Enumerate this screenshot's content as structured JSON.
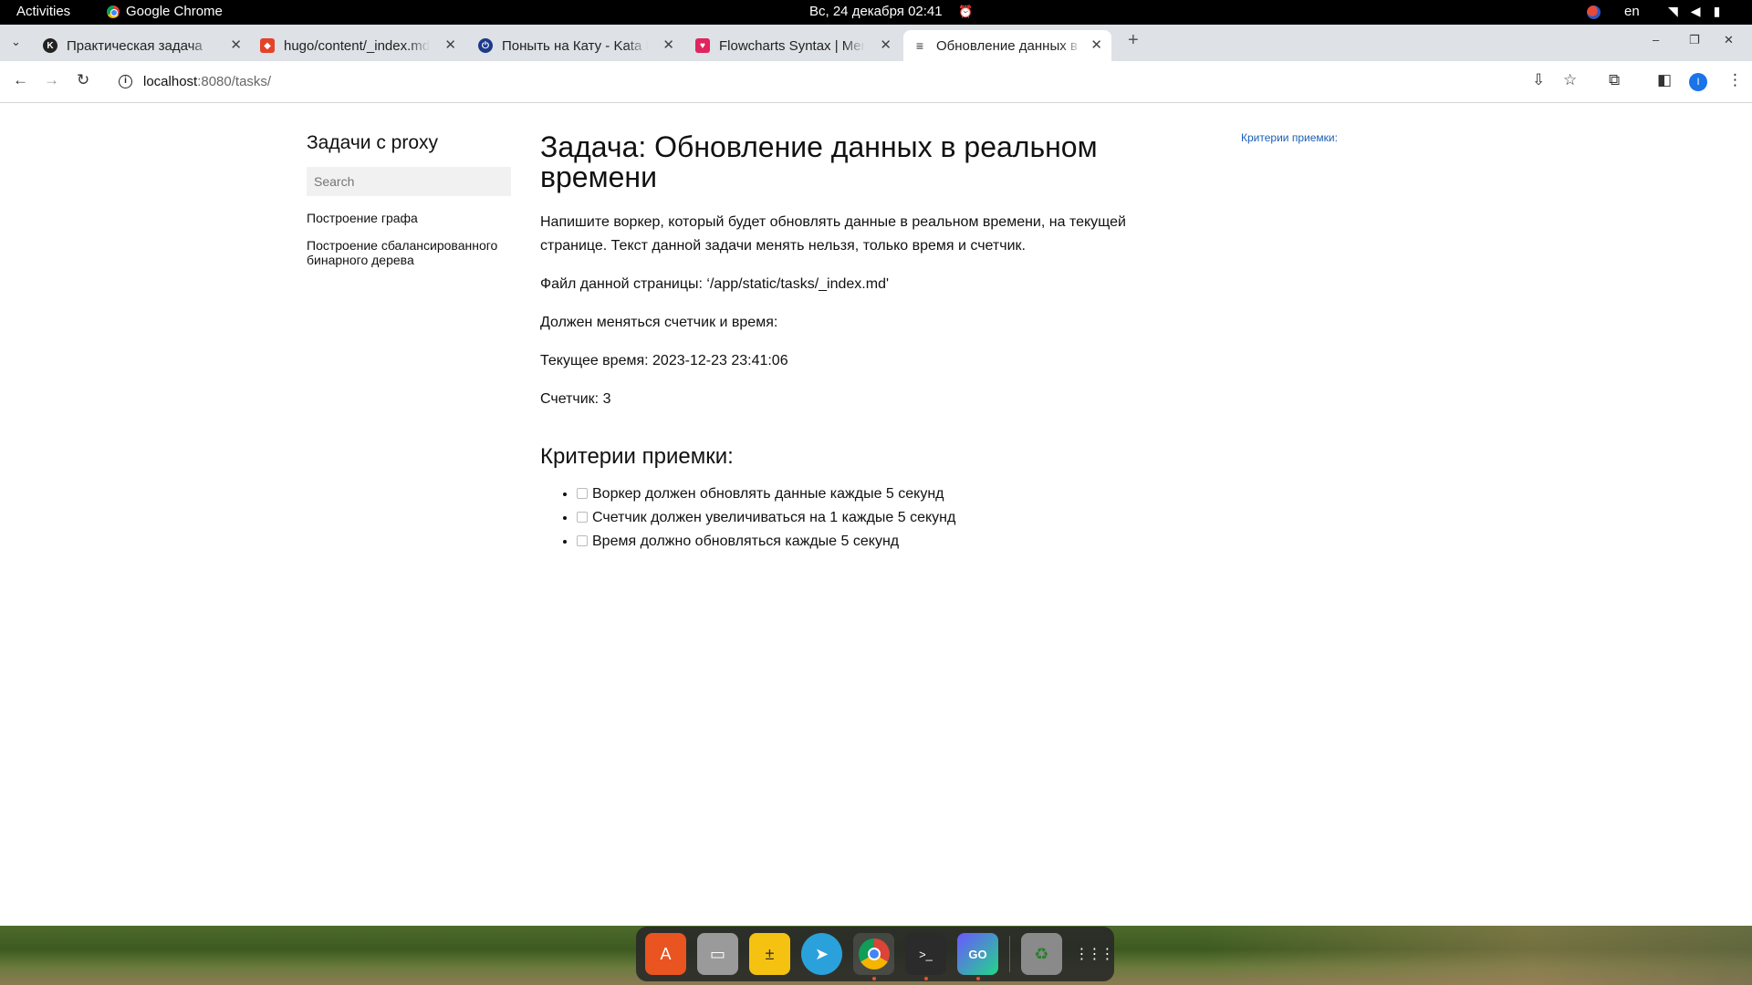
{
  "topbar": {
    "activities": "Activities",
    "app_name": "Google Chrome",
    "clock": "Вс, 24 декабря  02:41",
    "lang": "en"
  },
  "tabs": [
    {
      "title": "Практическая задача",
      "icon": "kata-icon",
      "color": "#222222"
    },
    {
      "title": "hugo/content/_index.md",
      "icon": "gitlab-icon",
      "color": "#e24329"
    },
    {
      "title": "Поныть на Кату - Kata M",
      "icon": "power-icon",
      "color": "#1e3a8a"
    },
    {
      "title": "Flowcharts Syntax | Mermaid",
      "icon": "mermaid-icon",
      "color": "#e0245e"
    },
    {
      "title": "Обновление данных в реальном",
      "icon": "document-icon",
      "color": "#444444"
    }
  ],
  "address_bar": {
    "host": "localhost",
    "rest": ":8080/tasks/"
  },
  "sidebar": {
    "title": "Задачи с proxy",
    "search_placeholder": "Search",
    "links": [
      {
        "label": "Построение графа"
      },
      {
        "label": "Построение сбалансированного бинарного дерева"
      }
    ]
  },
  "main": {
    "title": "Задача: Обновление данных в реальном времени",
    "p1": "Напишите воркер, который будет обновлять данные в реальном времени, на текущей странице. Текст данной задачи менять нельзя, только время и счетчик.",
    "p2": "Файл данной страницы: ‘/app/static/tasks/_index.md'",
    "p3": "Должен меняться счетчик и время:",
    "p4": "Текущее время: 2023-12-23 23:41:06",
    "p5": "Счетчик: 3",
    "criteria_title": "Критерии приемки:",
    "criteria": [
      "Воркер должен обновлять данные каждые 5 секунд",
      "Счетчик должен увеличиваться на 1 каждые 5 секунд",
      "Время должно обновляться каждые 5 секунд"
    ]
  },
  "toc": {
    "link": "Критерии приемки:"
  },
  "profile_initial": "I",
  "dock": [
    {
      "name": "app-center-icon",
      "color": "#e95420",
      "glyph": "A"
    },
    {
      "name": "files-icon",
      "color": "#8a8a8a",
      "glyph": "▭"
    },
    {
      "name": "calculator-icon",
      "color": "#f5c211",
      "glyph": "±"
    },
    {
      "name": "telegram-icon",
      "color": "#2aa1da",
      "glyph": "➤"
    },
    {
      "name": "chrome-icon",
      "color": "#4285f4",
      "glyph": "◉"
    },
    {
      "name": "terminal-icon",
      "color": "#333333",
      "glyph": ">_"
    },
    {
      "name": "goland-icon",
      "color": "#6b57ff",
      "glyph": "GO"
    },
    {
      "name": "trash-icon",
      "color": "#7a7a7a",
      "glyph": "♻"
    },
    {
      "name": "show-apps-icon",
      "color": "#555555",
      "glyph": "⋮⋮"
    }
  ]
}
